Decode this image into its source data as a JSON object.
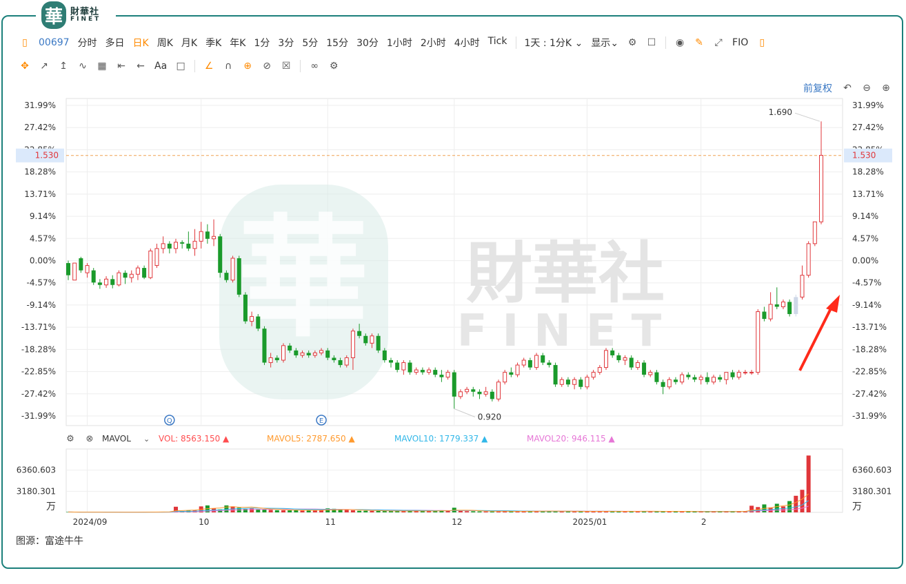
{
  "brand": {
    "seal_char": "華",
    "name_cn": "財華社",
    "name_en": "FINET"
  },
  "toolbar": {
    "code": "00697",
    "periods": [
      "分时",
      "多日",
      "日K",
      "周K",
      "月K",
      "季K",
      "年K",
      "1分",
      "3分",
      "5分",
      "15分",
      "30分",
      "1小时",
      "2小时",
      "4小时",
      "Tick"
    ],
    "active_period": "日K",
    "interval_select": "1天 : 1分K",
    "display_label": "显示",
    "fio_label": "FIO",
    "text_tool": "Aa",
    "adjust_label": "前复权"
  },
  "watermark": {
    "cn": "財華社",
    "en": "FINET"
  },
  "chart_data": {
    "type": "candlestick",
    "base_price": 1.2575,
    "y_ticks": [
      "31.99%",
      "27.42%",
      "22.85%",
      "18.28%",
      "13.71%",
      "9.14%",
      "4.57%",
      "0.00%",
      "-4.57%",
      "-9.14%",
      "-13.71%",
      "-18.28%",
      "-22.85%",
      "-27.42%",
      "-31.99%"
    ],
    "y_tick_values": [
      31.99,
      27.42,
      22.85,
      18.28,
      13.71,
      9.14,
      4.57,
      0.0,
      -4.57,
      -9.14,
      -13.71,
      -18.28,
      -22.85,
      -27.42,
      -31.99
    ],
    "ylim": [
      -31.99,
      31.99
    ],
    "x_ticks": [
      "2024/09",
      "10",
      "11",
      "12",
      "2025/01",
      "2"
    ],
    "x_tick_index": [
      3,
      21,
      41,
      61,
      82,
      100
    ],
    "current_price_label": "1.530",
    "current_price": 1.53,
    "high_label": "1.690",
    "low_label": "0.920",
    "event_markers": [
      {
        "label": "Q",
        "index": 16
      },
      {
        "label": "E",
        "index": 40
      }
    ],
    "candles_pct": [
      [
        -0.5,
        -3.0,
        -4.0,
        0.0
      ],
      [
        -4.0,
        -0.5,
        -3.5,
        -1.0
      ],
      [
        0.5,
        -2.0,
        -2.5,
        0.8
      ],
      [
        -2.5,
        -1.0,
        -3.5,
        -0.5
      ],
      [
        -2.0,
        -4.5,
        -5.0,
        -1.5
      ],
      [
        -4.5,
        -5.0,
        -5.8,
        -3.8
      ],
      [
        -5.0,
        -3.8,
        -5.6,
        -3.2
      ],
      [
        -3.8,
        -5.0,
        -5.7,
        -3.0
      ],
      [
        -5.0,
        -2.5,
        -5.3,
        -2.0
      ],
      [
        -2.5,
        -3.5,
        -4.8,
        -2.0
      ],
      [
        -3.5,
        -2.8,
        -4.5,
        -2.0
      ],
      [
        -2.8,
        -1.5,
        -4.0,
        -1.0
      ],
      [
        -1.5,
        -3.5,
        -3.8,
        -1.0
      ],
      [
        -3.5,
        2.0,
        -3.8,
        2.5
      ],
      [
        -1.0,
        2.5,
        -1.5,
        3.5
      ],
      [
        2.5,
        3.5,
        1.5,
        5.0
      ],
      [
        3.5,
        2.5,
        1.5,
        4.0
      ],
      [
        2.5,
        3.8,
        1.5,
        4.5
      ],
      [
        3.8,
        3.5,
        2.5,
        4.2
      ],
      [
        3.5,
        2.5,
        2.0,
        6.0
      ],
      [
        2.5,
        4.0,
        1.0,
        6.5
      ],
      [
        4.0,
        6.0,
        2.5,
        8.0
      ],
      [
        6.0,
        4.5,
        3.5,
        7.5
      ],
      [
        4.5,
        5.0,
        3.0,
        8.5
      ],
      [
        5.0,
        -2.5,
        -3.5,
        5.5
      ],
      [
        -2.5,
        -4.0,
        -4.5,
        -2.0
      ],
      [
        -4.0,
        0.5,
        -4.5,
        1.0
      ],
      [
        0.5,
        -7.0,
        -7.5,
        1.0
      ],
      [
        -7.0,
        -12.5,
        -13.0,
        -6.5
      ],
      [
        -12.5,
        -11.5,
        -13.5,
        -10.5
      ],
      [
        -11.5,
        -14.0,
        -14.5,
        -11.0
      ],
      [
        -14.0,
        -21.0,
        -21.5,
        -13.5
      ],
      [
        -21.0,
        -20.0,
        -22.0,
        -19.0
      ],
      [
        -20.0,
        -20.5,
        -21.0,
        -19.5
      ],
      [
        -20.5,
        -17.5,
        -21.0,
        -17.0
      ],
      [
        -17.5,
        -18.5,
        -19.0,
        -17.0
      ],
      [
        -18.5,
        -19.5,
        -20.0,
        -18.0
      ],
      [
        -19.5,
        -19.0,
        -20.0,
        -18.5
      ],
      [
        -19.0,
        -19.5,
        -20.0,
        -18.5
      ],
      [
        -19.5,
        -19.0,
        -20.0,
        -18.5
      ],
      [
        -19.0,
        -18.5,
        -19.5,
        -18.0
      ],
      [
        -18.5,
        -20.0,
        -20.5,
        -18.0
      ],
      [
        -20.0,
        -20.5,
        -21.0,
        -19.5
      ],
      [
        -20.5,
        -21.5,
        -22.0,
        -20.0
      ],
      [
        -21.5,
        -20.0,
        -22.0,
        -19.5
      ],
      [
        -20.0,
        -14.5,
        -22.5,
        -14.0
      ],
      [
        -14.5,
        -15.5,
        -16.0,
        -13.0
      ],
      [
        -15.5,
        -17.0,
        -17.5,
        -15.0
      ],
      [
        -17.0,
        -15.5,
        -18.0,
        -15.0
      ],
      [
        -15.5,
        -18.5,
        -19.0,
        -15.0
      ],
      [
        -18.5,
        -20.5,
        -21.0,
        -18.0
      ],
      [
        -20.5,
        -21.0,
        -22.0,
        -20.0
      ],
      [
        -21.0,
        -22.5,
        -23.0,
        -20.5
      ],
      [
        -22.5,
        -21.0,
        -23.5,
        -20.5
      ],
      [
        -21.0,
        -23.0,
        -23.5,
        -20.5
      ],
      [
        -23.0,
        -22.5,
        -23.5,
        -22.0
      ],
      [
        -22.5,
        -23.0,
        -23.5,
        -22.0
      ],
      [
        -23.0,
        -22.5,
        -23.5,
        -22.0
      ],
      [
        -22.5,
        -23.5,
        -24.0,
        -22.0
      ],
      [
        -23.5,
        -24.0,
        -25.0,
        -22.5
      ],
      [
        -24.0,
        -23.0,
        -24.5,
        -22.5
      ],
      [
        -23.0,
        -28.0,
        -30.5,
        -22.5
      ],
      [
        -28.0,
        -27.0,
        -28.5,
        -26.5
      ],
      [
        -27.0,
        -26.5,
        -27.5,
        -26.0
      ],
      [
        -26.5,
        -27.0,
        -28.0,
        -26.0
      ],
      [
        -27.0,
        -27.5,
        -28.5,
        -26.5
      ],
      [
        -27.5,
        -27.0,
        -28.0,
        -26.0
      ],
      [
        -27.0,
        -28.5,
        -29.0,
        -26.5
      ],
      [
        -28.5,
        -25.0,
        -29.0,
        -24.5
      ],
      [
        -25.0,
        -23.0,
        -25.5,
        -22.5
      ],
      [
        -23.0,
        -23.5,
        -24.0,
        -22.0
      ],
      [
        -23.5,
        -21.5,
        -24.0,
        -21.0
      ],
      [
        -21.5,
        -20.5,
        -22.0,
        -20.0
      ],
      [
        -20.5,
        -22.0,
        -22.5,
        -20.0
      ],
      [
        -22.0,
        -19.5,
        -22.5,
        -19.0
      ],
      [
        -19.5,
        -21.0,
        -21.5,
        -19.0
      ],
      [
        -21.0,
        -21.5,
        -22.0,
        -20.5
      ],
      [
        -21.5,
        -25.5,
        -26.0,
        -21.0
      ],
      [
        -25.5,
        -24.5,
        -26.0,
        -24.0
      ],
      [
        -24.5,
        -25.5,
        -26.0,
        -24.0
      ],
      [
        -25.5,
        -24.5,
        -26.5,
        -24.0
      ],
      [
        -24.5,
        -26.0,
        -26.5,
        -24.0
      ],
      [
        -26.0,
        -24.0,
        -26.5,
        -23.5
      ],
      [
        -24.0,
        -23.0,
        -24.5,
        -22.5
      ],
      [
        -23.0,
        -22.0,
        -23.5,
        -21.5
      ],
      [
        -22.0,
        -18.5,
        -22.5,
        -18.0
      ],
      [
        -18.5,
        -19.5,
        -20.0,
        -18.0
      ],
      [
        -19.5,
        -20.5,
        -21.0,
        -19.0
      ],
      [
        -20.5,
        -20.0,
        -21.5,
        -19.5
      ],
      [
        -20.0,
        -22.0,
        -22.5,
        -19.5
      ],
      [
        -22.0,
        -21.0,
        -22.5,
        -20.5
      ],
      [
        -21.0,
        -23.5,
        -24.0,
        -20.5
      ],
      [
        -23.5,
        -23.0,
        -24.0,
        -22.5
      ],
      [
        -23.0,
        -25.0,
        -25.5,
        -22.5
      ],
      [
        -25.0,
        -26.0,
        -27.5,
        -24.5
      ],
      [
        -26.0,
        -24.5,
        -26.5,
        -24.0
      ],
      [
        -24.5,
        -25.0,
        -25.5,
        -24.0
      ],
      [
        -25.0,
        -23.5,
        -25.5,
        -23.0
      ],
      [
        -23.5,
        -24.0,
        -24.5,
        -23.0
      ],
      [
        -24.0,
        -24.5,
        -25.0,
        -23.5
      ],
      [
        -24.5,
        -24.0,
        -25.5,
        -23.5
      ],
      [
        -24.0,
        -25.0,
        -25.5,
        -23.0
      ],
      [
        -25.0,
        -24.0,
        -25.5,
        -23.5
      ],
      [
        -24.0,
        -24.5,
        -25.0,
        -23.5
      ],
      [
        -24.5,
        -23.0,
        -25.5,
        -23.0
      ],
      [
        -23.0,
        -24.0,
        -24.5,
        -22.5
      ],
      [
        -24.0,
        -23.0,
        -24.5,
        -22.5
      ],
      [
        -23.0,
        -23.0,
        -23.5,
        -22.5
      ],
      [
        -23.0,
        -23.0,
        -23.5,
        -22.5
      ],
      [
        -23.0,
        -10.5,
        -23.5,
        -10.0
      ],
      [
        -10.5,
        -12.0,
        -12.5,
        -9.5
      ],
      [
        -12.0,
        -9.0,
        -12.5,
        -6.5
      ],
      [
        -9.0,
        -9.5,
        -10.0,
        -5.5
      ],
      [
        -9.5,
        -8.5,
        -10.0,
        -8.0
      ],
      [
        -8.5,
        -11.0,
        -11.5,
        -8.0
      ],
      [
        -11.0,
        -7.5,
        -11.5,
        -7.0
      ],
      [
        -7.5,
        -3.0,
        -8.0,
        -1.0
      ],
      [
        -3.0,
        3.5,
        -3.5,
        4.0
      ],
      [
        3.5,
        8.0,
        3.0,
        4.5
      ],
      [
        8.0,
        21.7,
        7.5,
        28.7
      ]
    ],
    "empty_candles": [
      115
    ],
    "volume_label": "万",
    "volume_ticks": [
      "6360.603",
      "3180.301"
    ],
    "volume_tick_values": [
      6360.603,
      3180.301
    ],
    "volume_max": 9540.904,
    "volume_legend": {
      "title": "MAVOL",
      "items": [
        {
          "text": "VOL: 8563.150",
          "color": "#ff4d4f"
        },
        {
          "text": "MAVOL5: 2787.650",
          "color": "#ff9a2e"
        },
        {
          "text": "MAVOL10: 1779.337",
          "color": "#31b7e8"
        },
        {
          "text": "MAVOL20: 946.115",
          "color": "#e676d6"
        }
      ]
    },
    "volumes": [
      60,
      40,
      30,
      50,
      20,
      40,
      30,
      20,
      30,
      30,
      20,
      30,
      40,
      60,
      80,
      80,
      90,
      850,
      200,
      300,
      300,
      900,
      1050,
      600,
      450,
      1050,
      900,
      700,
      520,
      600,
      480,
      420,
      380,
      330,
      320,
      300,
      320,
      280,
      300,
      360,
      380,
      600,
      540,
      400,
      360,
      320,
      240,
      240,
      230,
      220,
      200,
      200,
      200,
      210,
      220,
      230,
      200,
      210,
      220,
      320,
      300,
      700,
      240,
      180,
      170,
      150,
      130,
      130,
      130,
      160,
      130,
      140,
      140,
      180,
      200,
      200,
      200,
      160,
      160,
      150,
      150,
      160,
      160,
      190,
      150,
      140,
      150,
      130,
      140,
      160,
      170,
      200,
      170,
      140,
      140,
      170,
      160,
      110,
      120,
      120,
      120,
      120,
      150,
      130,
      140,
      130,
      150,
      120,
      1000,
      800,
      1200,
      750,
      1300,
      900,
      1700,
      2500,
      3400,
      8563
    ],
    "mavol5": [
      60,
      50,
      43,
      45,
      40,
      35,
      30,
      30,
      30,
      27,
      28,
      30,
      34,
      42,
      55,
      68,
      80,
      240,
      270,
      306,
      350,
      450,
      560,
      610,
      660,
      810,
      860,
      780,
      770,
      800,
      700,
      600,
      520,
      480,
      420,
      380,
      350,
      330,
      320,
      310,
      320,
      360,
      380,
      400,
      420,
      410,
      360,
      330,
      300,
      270,
      240,
      220,
      210,
      210,
      210,
      210,
      210,
      210,
      210,
      230,
      240,
      320,
      320,
      330,
      310,
      250,
      200,
      180,
      170,
      170,
      160,
      150,
      150,
      150,
      170,
      180,
      190,
      190,
      180,
      180,
      170,
      160,
      160,
      160,
      160,
      160,
      160,
      160,
      150,
      150,
      160,
      170,
      170,
      170,
      160,
      160,
      160,
      150,
      150,
      140,
      130,
      120,
      130,
      130,
      130,
      130,
      140,
      140,
      320,
      430,
      600,
      680,
      880,
      990,
      1130,
      1500,
      2000,
      2788
    ],
    "mavol10": [
      60,
      50,
      43,
      45,
      40,
      38,
      35,
      33,
      32,
      30,
      29,
      30,
      31,
      35,
      40,
      45,
      50,
      140,
      150,
      170,
      180,
      250,
      300,
      340,
      380,
      450,
      520,
      570,
      600,
      630,
      630,
      630,
      620,
      610,
      600,
      560,
      510,
      470,
      450,
      440,
      440,
      430,
      420,
      420,
      420,
      420,
      410,
      400,
      380,
      370,
      350,
      340,
      320,
      310,
      300,
      300,
      280,
      270,
      260,
      260,
      250,
      270,
      280,
      280,
      290,
      280,
      270,
      260,
      250,
      240,
      230,
      220,
      200,
      190,
      180,
      170,
      170,
      170,
      170,
      170,
      170,
      170,
      170,
      170,
      170,
      170,
      170,
      170,
      160,
      160,
      160,
      160,
      160,
      160,
      160,
      160,
      160,
      160,
      150,
      150,
      150,
      150,
      150,
      150,
      150,
      150,
      150,
      150,
      230,
      290,
      380,
      420,
      520,
      570,
      650,
      830,
      1120,
      1779
    ],
    "mavol20": [
      60,
      50,
      43,
      45,
      40,
      38,
      36,
      34,
      33,
      32,
      31,
      31,
      31,
      33,
      35,
      37,
      40,
      80,
      90,
      100,
      110,
      150,
      190,
      220,
      250,
      300,
      350,
      380,
      410,
      430,
      450,
      460,
      470,
      480,
      490,
      500,
      500,
      500,
      500,
      500,
      480,
      470,
      460,
      450,
      440,
      430,
      410,
      390,
      380,
      370,
      360,
      350,
      340,
      330,
      320,
      320,
      310,
      300,
      290,
      280,
      270,
      270,
      270,
      260,
      260,
      260,
      250,
      250,
      240,
      230,
      220,
      210,
      210,
      200,
      200,
      200,
      200,
      200,
      200,
      190,
      190,
      190,
      180,
      180,
      180,
      180,
      180,
      170,
      170,
      170,
      170,
      170,
      170,
      160,
      160,
      160,
      160,
      160,
      160,
      160,
      150,
      150,
      150,
      150,
      150,
      150,
      150,
      150,
      190,
      220,
      260,
      280,
      330,
      360,
      400,
      490,
      640,
      946
    ]
  },
  "source": "图源：富途牛牛",
  "colors": {
    "up": "#e0363a",
    "down": "#1a9a2b",
    "accent": "#ff8a00",
    "frame": "#1a7f7a",
    "price_line": "#f0a050"
  }
}
